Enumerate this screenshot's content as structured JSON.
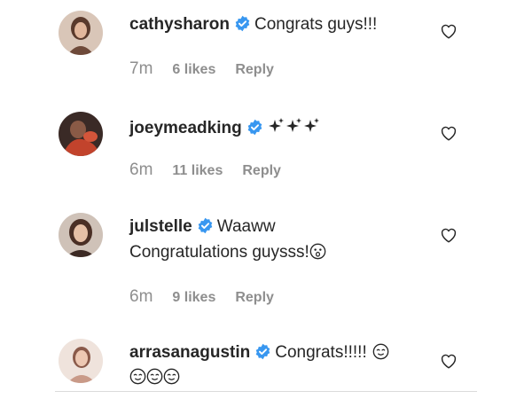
{
  "comments": [
    {
      "username": "cathysharon",
      "text": "Congrats guys!!!",
      "time": "7m",
      "likes": "6 likes",
      "reply": "Reply",
      "avatar_color": "#7a5a4a"
    },
    {
      "username": "joeymeadking",
      "text": "",
      "emoji": "sparkles",
      "time": "6m",
      "likes": "11 likes",
      "reply": "Reply",
      "avatar_color": "#b8452f"
    },
    {
      "username": "julstelle",
      "text": "Waaww",
      "text_line2": "Congratulations guysss!",
      "emoji": "astonished-face",
      "time": "6m",
      "likes": "9 likes",
      "reply": "Reply",
      "avatar_color": "#5a4035"
    },
    {
      "username": "arrasanagustin",
      "text": "Congrats!!!!!",
      "emoji": "relieved-face",
      "emoji_line2_count": 3,
      "avatar_color": "#c9a596"
    }
  ],
  "icons": {
    "verified": "verified-badge-icon",
    "like": "heart-outline-icon"
  },
  "colors": {
    "verified_blue": "#3897f0",
    "text": "#262626",
    "meta": "#8e8e8e",
    "divider": "#dbdbdb"
  }
}
